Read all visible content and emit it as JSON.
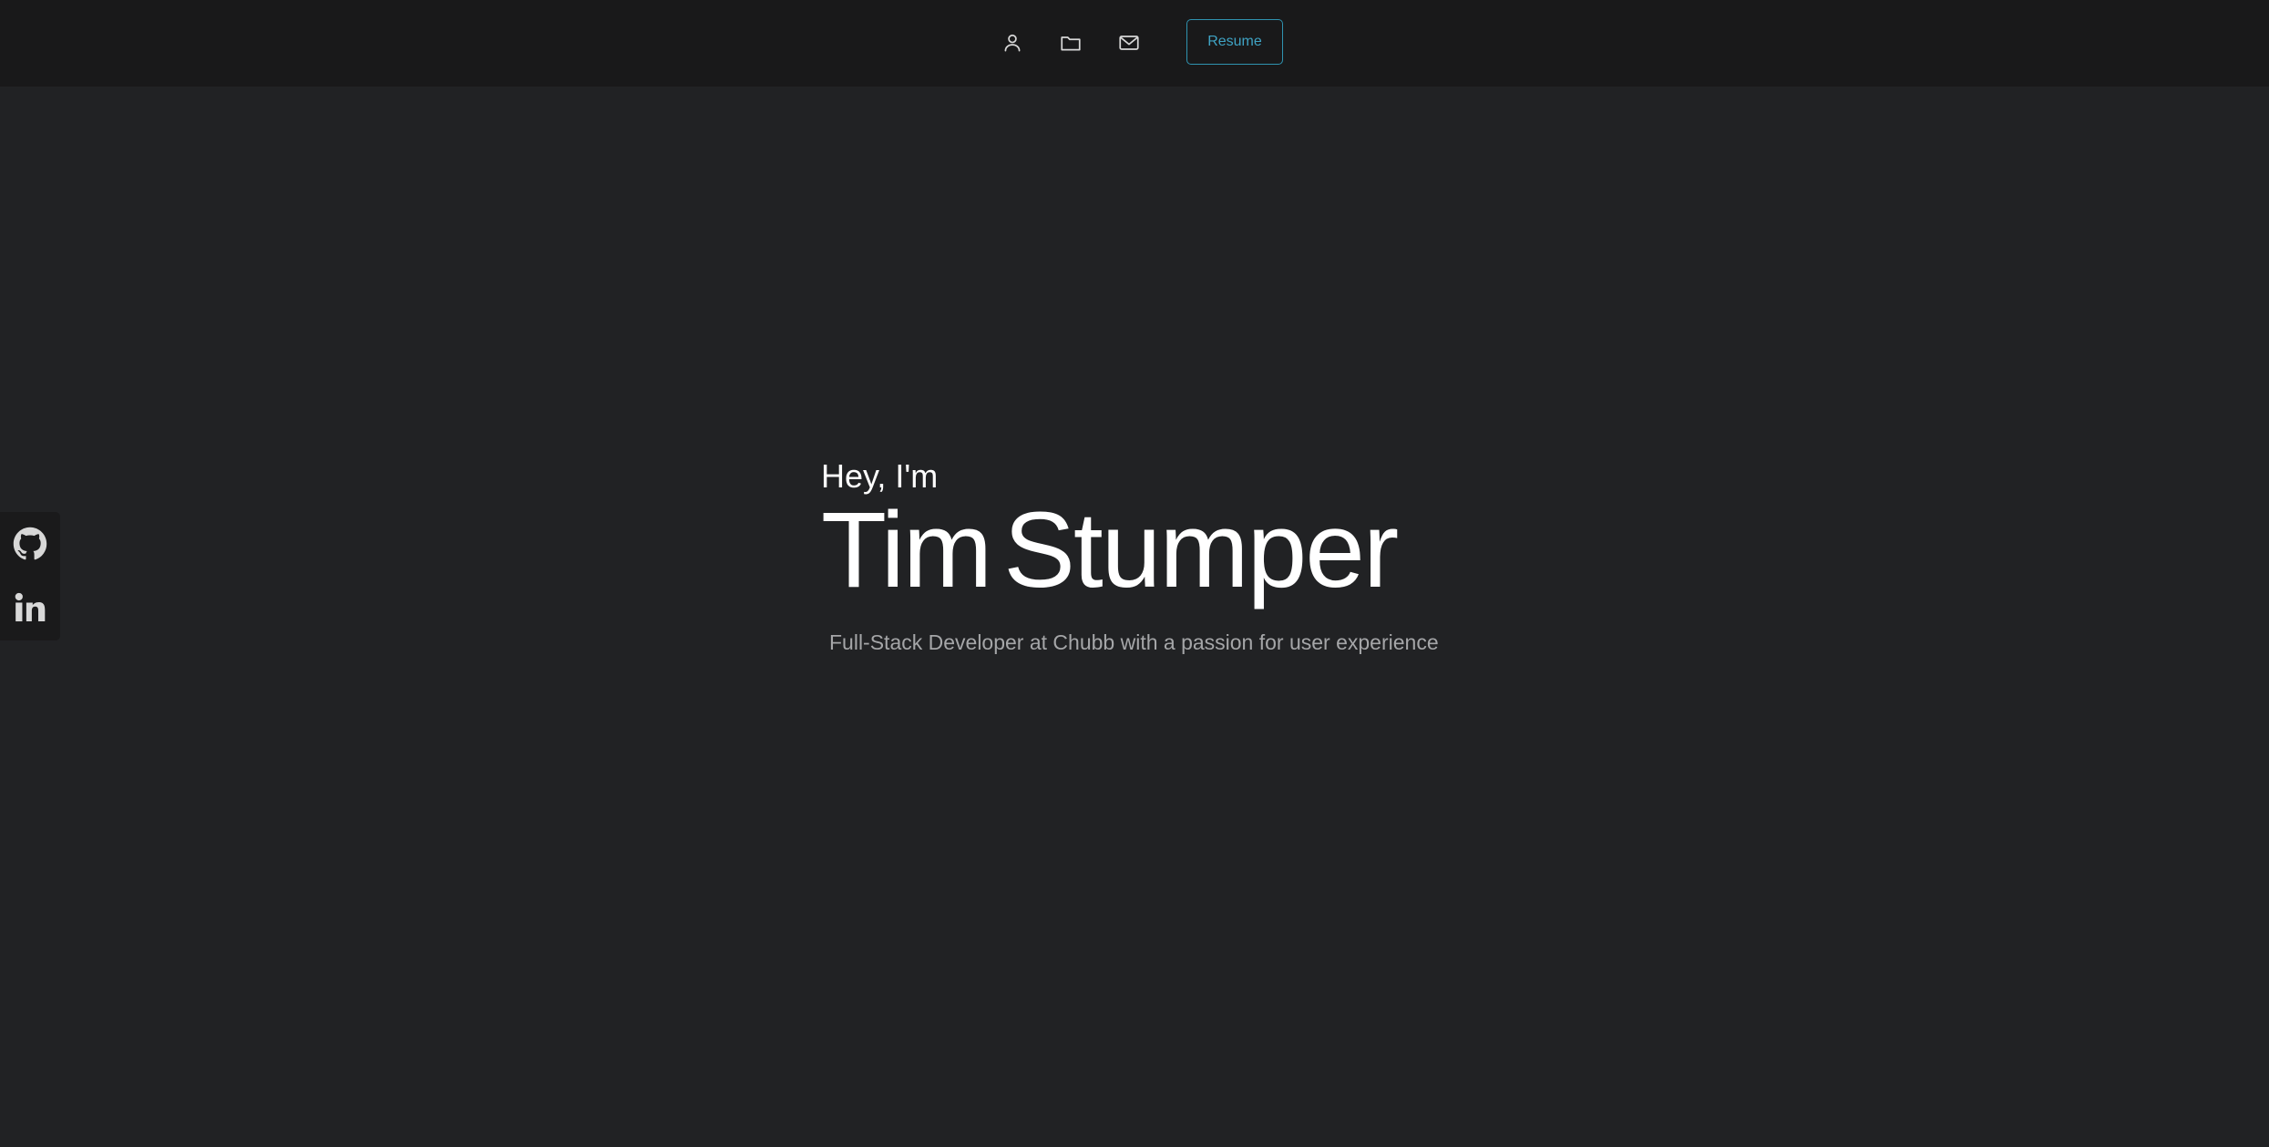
{
  "nav": {
    "icons": [
      "user-icon",
      "folder-icon",
      "mail-icon"
    ],
    "resume_label": "Resume",
    "accent": "#3fa3c4"
  },
  "hero": {
    "greeting": "Hey, I'm",
    "first_name": "Tim",
    "last_name": "Stumper",
    "subtitle": "Full-Stack Developer at Chubb with a passion for user experience"
  },
  "social": {
    "icons": [
      "github-icon",
      "linkedin-icon"
    ]
  },
  "colors": {
    "background": "#212224",
    "topbar": "#19191a",
    "text": "#ffffff",
    "subtitle": "#a5a6a8"
  }
}
